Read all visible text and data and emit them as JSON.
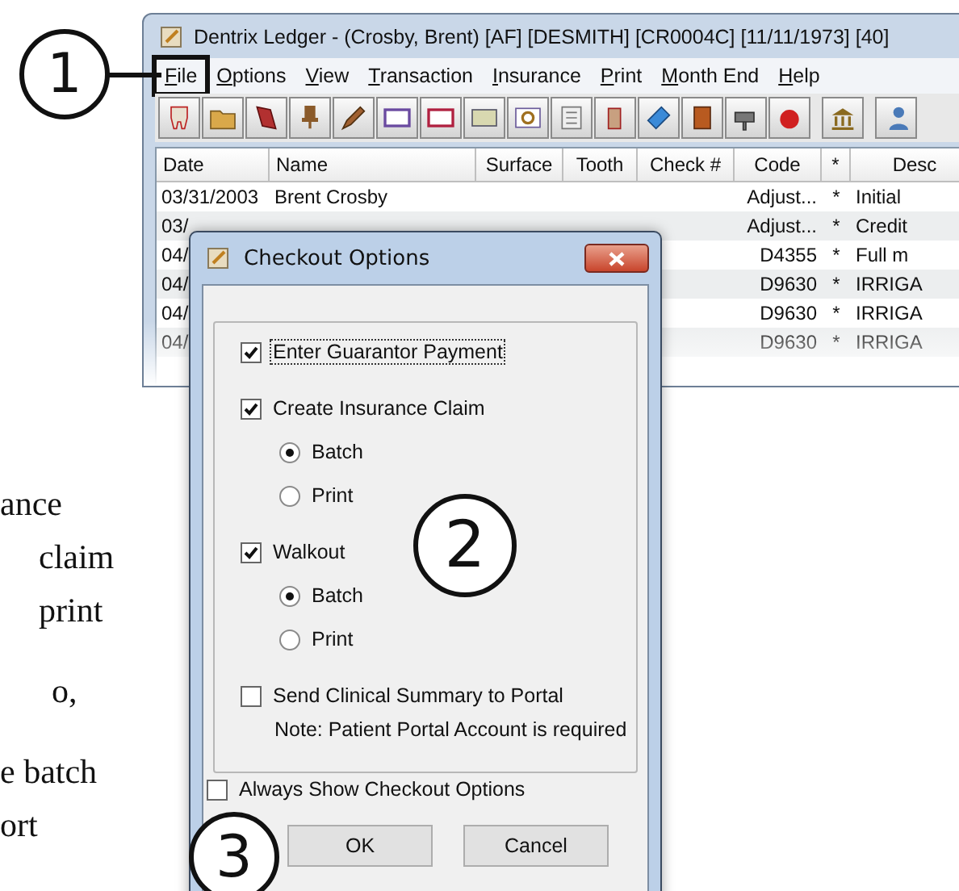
{
  "side_text": [
    "ance",
    "claim",
    "print",
    "o,",
    "e batch",
    "ort"
  ],
  "ledger": {
    "title": "Dentrix Ledger - (Crosby, Brent) [AF] [DESMITH] [CR0004C] [11/11/1973] [40]",
    "menu": [
      {
        "label": "File",
        "boxed": true
      },
      {
        "label": "Options",
        "boxed": false
      },
      {
        "label": "View",
        "boxed": false
      },
      {
        "label": "Transaction",
        "boxed": false
      },
      {
        "label": "Insurance",
        "boxed": false
      },
      {
        "label": "Print",
        "boxed": false
      },
      {
        "label": "Month End",
        "boxed": false
      },
      {
        "label": "Help",
        "boxed": false
      }
    ],
    "columns": [
      "Date",
      "Name",
      "Surface",
      "Tooth",
      "Check #",
      "Code",
      "*",
      "Desc"
    ],
    "rows": [
      {
        "date": "03/31/2003",
        "name": "Brent Crosby",
        "code": "Adjust...",
        "star": "*",
        "description": "Initial"
      },
      {
        "date": "03/",
        "code": "Adjust...",
        "star": "*",
        "description": "Credit"
      },
      {
        "date": "04/",
        "code": "D4355",
        "star": "*",
        "description": "Full m"
      },
      {
        "date": "04/",
        "code": "D9630",
        "star": "*",
        "description": "IRRIGA"
      },
      {
        "date": "04/",
        "code": "D9630",
        "star": "*",
        "description": "IRRIGA"
      },
      {
        "date": "04/",
        "code": "D9630",
        "star": "*",
        "description": "IRRIGA"
      }
    ]
  },
  "dialog": {
    "title": "Checkout Options",
    "options": [
      {
        "kind": "checkbox",
        "label": "Enter Guarantor Payment",
        "checked": true,
        "focused": true
      },
      {
        "kind": "checkbox",
        "label": "Create Insurance Claim",
        "checked": true,
        "focused": false
      },
      {
        "kind": "radio",
        "label": "Batch",
        "selected": true
      },
      {
        "kind": "radio",
        "label": "Print",
        "selected": false
      },
      {
        "kind": "checkbox",
        "label": "Walkout",
        "checked": true,
        "focused": false
      },
      {
        "kind": "radio",
        "label": "Batch",
        "selected": true
      },
      {
        "kind": "radio",
        "label": "Print",
        "selected": false
      },
      {
        "kind": "checkbox",
        "label": "Send Clinical Summary to Portal",
        "checked": false,
        "focused": false
      },
      {
        "kind": "note",
        "label": "Note: Patient Portal Account is required"
      }
    ],
    "always_show": {
      "label": "Always Show Checkout Options",
      "checked": false
    },
    "buttons": [
      "OK",
      "Cancel"
    ]
  },
  "callouts": [
    "1",
    "2",
    "3"
  ]
}
